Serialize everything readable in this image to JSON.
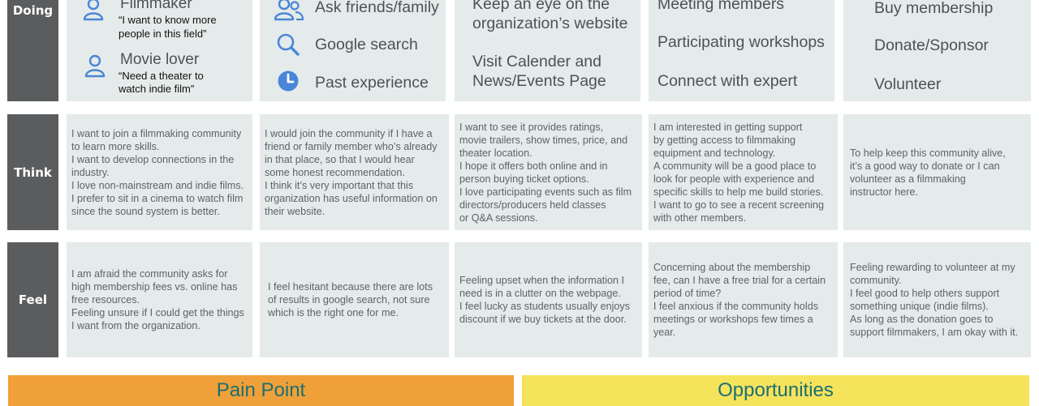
{
  "rows": {
    "doing": "Doing",
    "think": "Think",
    "feel": "Feel"
  },
  "doing": {
    "col1": {
      "filmmaker": {
        "title": "Filmmaker",
        "quote1": "“I want to know more",
        "quote2": "people in this field”",
        "icon": "person-icon"
      },
      "movie_lover": {
        "title": "Movie lover",
        "quote1": "“Need a theater to",
        "quote2": "watch indie film”",
        "icon": "person-icon"
      }
    },
    "col2": [
      {
        "label": "Ask friends/family",
        "icon": "people-icon"
      },
      {
        "label": "Google search",
        "icon": "search-icon"
      },
      {
        "label": "Past experience",
        "icon": "clock-icon"
      }
    ],
    "col3": {
      "item1_line1": "Keep an eye on the",
      "item1_line2": "organization’s website",
      "item2_line1": "Visit Calender and",
      "item2_line2": "News/Events Page"
    },
    "col4": [
      "Meeting members",
      "Participating workshops",
      "Connect with expert"
    ],
    "col5": [
      "Buy membership",
      "Donate/Sponsor",
      "Volunteer"
    ]
  },
  "think": [
    [
      "I want to join a filmmaking community",
      "to learn more skills.",
      "I want to develop connections in the",
      "industry.",
      "I love non-mainstream and indie films.",
      "I prefer to sit in a cinema to watch film",
      "since the sound system is better."
    ],
    [
      "I would join the community if I have a",
      "friend or family member who’s already",
      "in that place, so that I would hear",
      "some honest recommendation.",
      "I think it’s very important that this",
      "organization has useful information on",
      "their website."
    ],
    [
      "I want to see it provides ratings,",
      "movie trailers, show times, price, and",
      "theater location.",
      "I hope it offers both online and in",
      "person buying ticket options.",
      "I love participating events such as film",
      "directors/producers held classes",
      "or Q&A sessions."
    ],
    [
      "I am interested in getting support",
      "by getting access to filmmaking",
      "equipment and technology.",
      "A community will be a good place to",
      "look for people with experience and",
      "specific skills to help me build stories.",
      "I want to go to see a recent screening",
      "with other members."
    ],
    [
      "To help keep this community alive,",
      "it’s a good way to donate or I can",
      "volunteer as a filmmaking",
      "instructor here."
    ]
  ],
  "feel": [
    [
      "I am afraid the community asks for",
      "high membership fees vs. online has",
      "free resources.",
      "Feeling unsure if I could get the things",
      "I want from the organization."
    ],
    [
      "I feel hesitant because there are lots",
      "of results in google search, not sure",
      "which is the right one for me."
    ],
    [
      "Feeling upset when the information I",
      "need is in a clutter on the webpage.",
      "I feel lucky as students usually enjoys",
      "discount if we buy tickets at the door."
    ],
    [
      "Concerning about the membership",
      "fee, can I have a free trial for a certain",
      "period of time?",
      "I feel anxious if the community holds",
      "meetings or workshops few times a",
      "year."
    ],
    [
      "Feeling rewarding to volunteer at my",
      "community.",
      "I feel good to help others support",
      "something unique (indie films).",
      "As long as the donation goes to",
      "support filmmakers, I am okay with it."
    ]
  ],
  "banners": {
    "pain_point": "Pain Point",
    "opportunities": "Opportunities"
  },
  "colors": {
    "label_bg": "#5a5c5e",
    "cell_bg": "#e5ebea",
    "icon_blue": "#4a86d8",
    "pain_bg": "#f0a038",
    "opp_bg": "#f5e35c",
    "opp_text": "#1b6f73"
  }
}
